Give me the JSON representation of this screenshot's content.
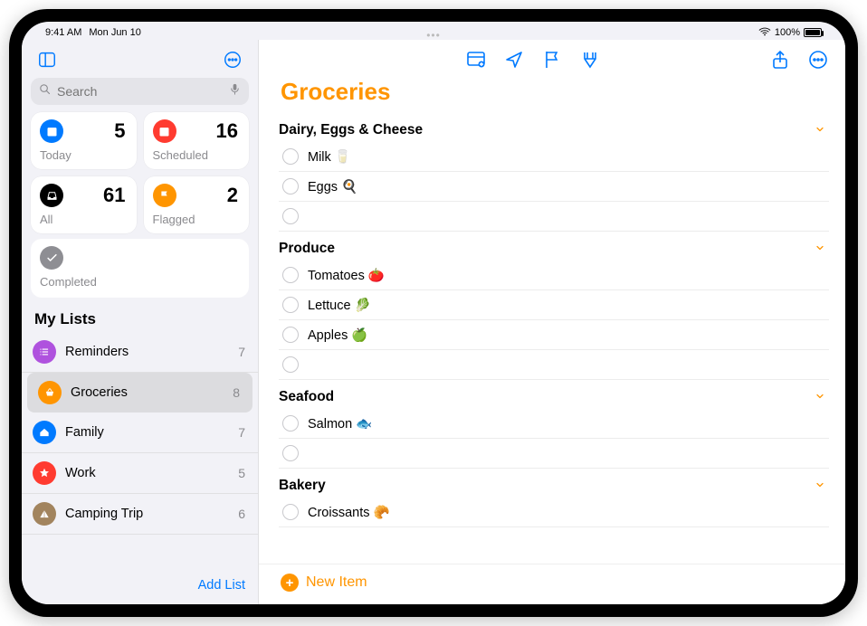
{
  "status": {
    "time": "9:41 AM",
    "date": "Mon Jun 10",
    "battery": "100%"
  },
  "sidebar": {
    "search_placeholder": "Search",
    "smart": [
      {
        "name": "Today",
        "count": 5,
        "color": "#007aff",
        "icon": "calendar"
      },
      {
        "name": "Scheduled",
        "count": 16,
        "color": "#ff3b30",
        "icon": "calendar"
      },
      {
        "name": "All",
        "count": 61,
        "color": "#000000",
        "icon": "tray"
      },
      {
        "name": "Flagged",
        "count": 2,
        "color": "#ff9500",
        "icon": "flag"
      }
    ],
    "completed_label": "Completed",
    "lists_header": "My Lists",
    "lists": [
      {
        "name": "Reminders",
        "count": 7,
        "color": "#af52de",
        "icon": "list"
      },
      {
        "name": "Groceries",
        "count": 8,
        "color": "#ff9500",
        "icon": "basket",
        "selected": true
      },
      {
        "name": "Family",
        "count": 7,
        "color": "#007aff",
        "icon": "home"
      },
      {
        "name": "Work",
        "count": 5,
        "color": "#ff3b30",
        "icon": "star"
      },
      {
        "name": "Camping Trip",
        "count": 6,
        "color": "#a2845e",
        "icon": "tent"
      }
    ],
    "add_list_label": "Add List"
  },
  "main": {
    "title": "Groceries",
    "accent": "#ff9500",
    "sections": [
      {
        "title": "Dairy, Eggs & Cheese",
        "items": [
          {
            "text": "Milk 🥛"
          },
          {
            "text": "Eggs 🍳"
          },
          {
            "text": "",
            "empty": true
          }
        ]
      },
      {
        "title": "Produce",
        "items": [
          {
            "text": "Tomatoes 🍅"
          },
          {
            "text": "Lettuce 🥬"
          },
          {
            "text": "Apples 🍏"
          },
          {
            "text": "",
            "empty": true
          }
        ]
      },
      {
        "title": "Seafood",
        "items": [
          {
            "text": "Salmon 🐟"
          },
          {
            "text": "",
            "empty": true
          }
        ]
      },
      {
        "title": "Bakery",
        "items": [
          {
            "text": "Croissants 🥐"
          }
        ]
      }
    ],
    "new_item_label": "New Item"
  }
}
